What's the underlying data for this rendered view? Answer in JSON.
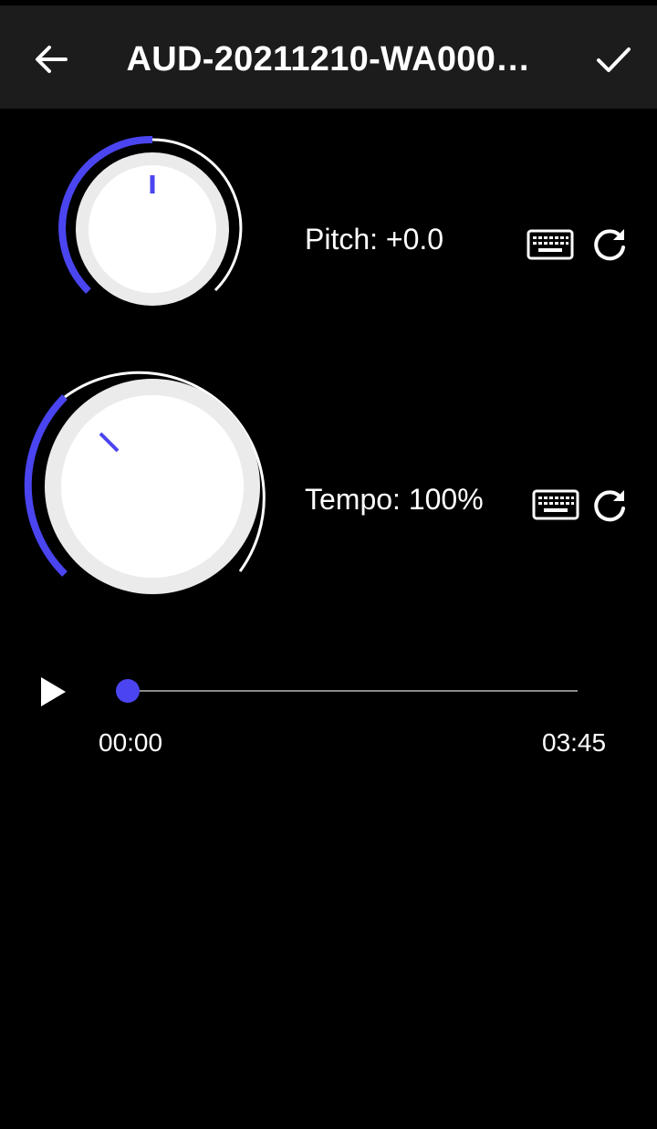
{
  "header": {
    "title": "AUD-20211210-WA000…",
    "back_icon": "arrow-left-icon",
    "confirm_icon": "checkmark-icon"
  },
  "pitch": {
    "label": "Pitch: +0.0",
    "value": 0.0,
    "keyboard_icon": "keyboard-icon",
    "reset_icon": "refresh-icon"
  },
  "tempo": {
    "label": "Tempo: 100%",
    "value_percent": 100,
    "keyboard_icon": "keyboard-icon",
    "reset_icon": "refresh-icon"
  },
  "player": {
    "play_icon": "play-icon",
    "current_time": "00:00",
    "total_time": "03:45",
    "progress": 0
  },
  "colors": {
    "accent": "#4a45f0",
    "background": "#000000",
    "app_bar": "#1c1c1c",
    "knob_face": "#ffffff",
    "knob_bezel": "#ebebeb",
    "track": "#8a8a8a"
  }
}
